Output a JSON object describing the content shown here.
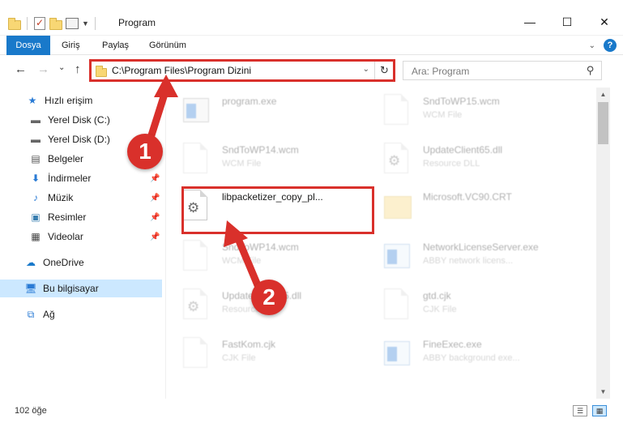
{
  "window": {
    "title": "Program",
    "minimize_glyph": "—",
    "maximize_glyph": "☐",
    "close_glyph": "✕"
  },
  "ribbon": {
    "tabs": [
      {
        "label": "Dosya"
      },
      {
        "label": "Giriş"
      },
      {
        "label": "Paylaş"
      },
      {
        "label": "Görünüm"
      }
    ],
    "expand_glyph": "⌄",
    "help_glyph": "?"
  },
  "nav": {
    "back_glyph": "←",
    "forward_glyph": "→",
    "recent_glyph": "⌄",
    "up_glyph": "↑"
  },
  "address": {
    "path": "C:\\Program Files\\Program Dizini",
    "dropdown_glyph": "⌄",
    "refresh_glyph": "↻"
  },
  "search": {
    "placeholder": "Ara: Program",
    "icon": "search-icon"
  },
  "sidebar": {
    "items": [
      {
        "label": "Hızlı erişim",
        "icon": "star-icon",
        "pinned": false
      },
      {
        "label": "Yerel Disk (C:)",
        "icon": "drive-icon",
        "pinned": false
      },
      {
        "label": "Yerel Disk (D:)",
        "icon": "drive-icon",
        "pinned": false
      },
      {
        "label": "Belgeler",
        "icon": "documents-icon",
        "pinned": false
      },
      {
        "label": "İndirmeler",
        "icon": "download-icon",
        "pinned": true
      },
      {
        "label": "Müzik",
        "icon": "music-icon",
        "pinned": true
      },
      {
        "label": "Resimler",
        "icon": "pictures-icon",
        "pinned": true
      },
      {
        "label": "Videolar",
        "icon": "video-icon",
        "pinned": true
      },
      {
        "label": "OneDrive",
        "icon": "cloud-icon",
        "pinned": false
      },
      {
        "label": "Bu bilgisayar",
        "icon": "computer-icon",
        "pinned": false,
        "selected": true
      },
      {
        "label": "Ağ",
        "icon": "network-icon",
        "pinned": false
      }
    ],
    "pin_glyph": "📌"
  },
  "files": [
    {
      "name": "program.exe",
      "type": "",
      "icon": "exe-icon",
      "faded": true
    },
    {
      "name": "SndToWP15.wcm",
      "type": "WCM File",
      "icon": "document-icon",
      "faded": true
    },
    {
      "name": "SndToWP14.wcm",
      "type": "WCM File",
      "icon": "document-icon",
      "faded": true
    },
    {
      "name": "UpdateClient65.dll",
      "type": "Resource DLL",
      "icon": "dll-icon",
      "faded": true
    },
    {
      "name": "libpacketizer_copy_pl...",
      "type": "",
      "icon": "dll-gear-icon",
      "faded": false
    },
    {
      "name": "Microsoft.VC90.CRT",
      "type": "",
      "icon": "folder-icon",
      "faded": true
    },
    {
      "name": "SndToWP14.wcm",
      "type": "WCM File",
      "icon": "document-icon",
      "faded": true
    },
    {
      "name": "NetworkLicenseServer.exe",
      "type": "ABBY network licens...",
      "icon": "app-icon",
      "faded": true
    },
    {
      "name": "UpdateClient65.dll",
      "type": "Resource DLL",
      "icon": "dll-icon",
      "faded": true
    },
    {
      "name": "gtd.cjk",
      "type": "CJK File",
      "icon": "document-icon",
      "faded": true
    },
    {
      "name": "FastKom.cjk",
      "type": "CJK File",
      "icon": "document-icon",
      "faded": true
    },
    {
      "name": "FineExec.exe",
      "type": "ABBY background exe...",
      "icon": "app-icon",
      "faded": true
    }
  ],
  "annotations": {
    "badge1": "1",
    "badge2": "2",
    "highlight_color": "#d9302b"
  },
  "status": {
    "count_text": "102 öğe"
  },
  "colors": {
    "accent": "#1979ca",
    "selected_bg": "#cce8ff",
    "annotation_red": "#d9302b"
  }
}
